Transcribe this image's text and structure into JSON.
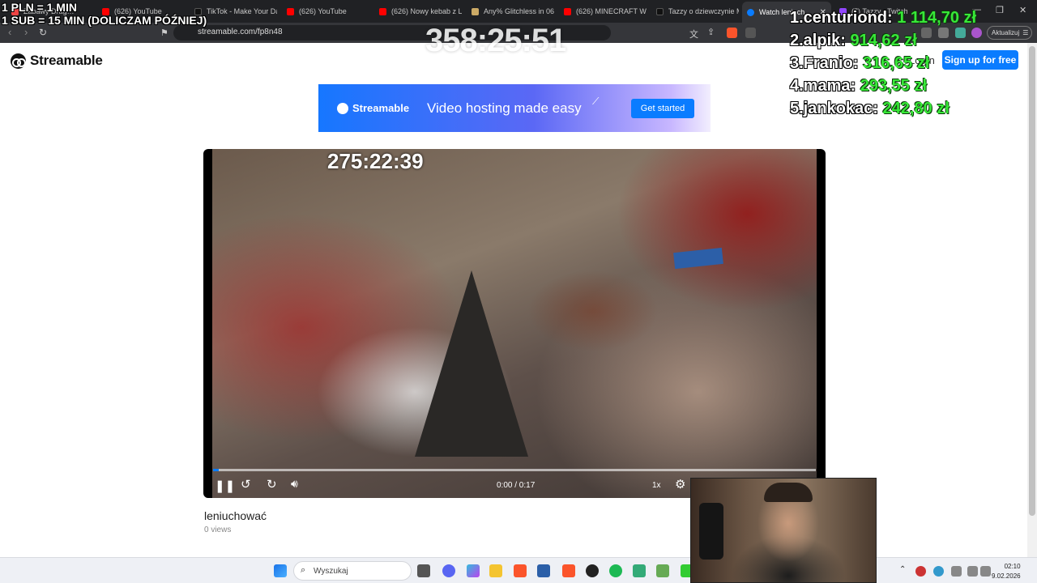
{
  "browser": {
    "tabs": [
      {
        "label": "Zabawy Drag…",
        "fav": "#e44"
      },
      {
        "label": "(626) YouTube",
        "fav": "#f00"
      },
      {
        "label": "TikTok - Make Your Day",
        "fav": "#111"
      },
      {
        "label": "(626) YouTube",
        "fav": "#f00"
      },
      {
        "label": "(626) Nowy kebab z Li…",
        "fav": "#f00"
      },
      {
        "label": "Any% Glitchless in 06:4…",
        "fav": "#ca6"
      },
      {
        "label": "(626) MINECRAFT WO…",
        "fav": "#f00"
      },
      {
        "label": "Tazzy o dziewczynie M…",
        "fav": "#111"
      },
      {
        "label": "Watch leniuch…",
        "fav": "#0a7cff"
      },
      {
        "label": "(7) Tazzy - Twitch",
        "fav": "#9146ff"
      }
    ],
    "url": "streamable.com/fp8n48",
    "update_label": "Aktualizuj"
  },
  "page": {
    "logo_text": "Streamable",
    "login_label": "Login",
    "signup_label": "Sign up for free",
    "banner": {
      "brand": "Streamable",
      "tagline": "Video hosting made easy",
      "cta": "Get started"
    },
    "video": {
      "overlay_timer": "275:22:39",
      "timecode": "0:00 / 0:17",
      "speed": "1x",
      "progress": 0.01,
      "title": "leniuchować",
      "views": "0 views"
    }
  },
  "overlay": {
    "rule1": "1 PLN = 1 MIN",
    "rule2": "1 SUB = 15 MIN (DOLICZAM PÓŹNIEJ)",
    "timer": "358:25:51",
    "leaderboard": [
      {
        "name": "1.centuriond:",
        "amount": "1 114,70 zł"
      },
      {
        "name": "2.alpik:",
        "amount": "914,62 zł"
      },
      {
        "name": "3.Franio:",
        "amount": "316,65 zł"
      },
      {
        "name": "4.mama:",
        "amount": "293,55 zł"
      },
      {
        "name": "5.jankokac:",
        "amount": "242,80 zł"
      }
    ]
  },
  "taskbar": {
    "search_placeholder": "Wyszukaj",
    "time": "02:10",
    "date": "9.02.2026"
  }
}
